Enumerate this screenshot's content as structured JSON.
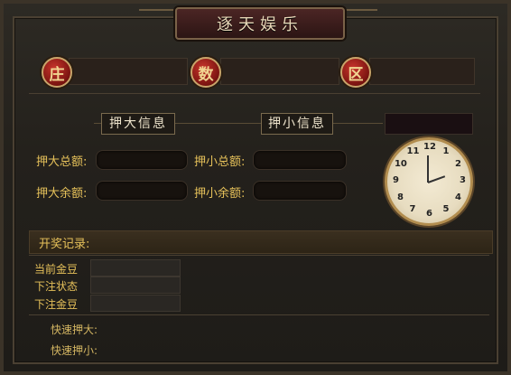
{
  "window": {
    "title": "逐天娱乐"
  },
  "orbs": {
    "left": "庄",
    "middle": "数",
    "right": "区"
  },
  "tabs": {
    "big_info": "押大信息",
    "small_info": "押小信息"
  },
  "labels": {
    "big_total": "押大总额:",
    "small_total": "押小总额:",
    "big_remaining": "押大余额:",
    "small_remaining": "押小余额:"
  },
  "records": {
    "label": "开奖记录:"
  },
  "status": {
    "gold_label": "当前金豆",
    "bet_status_label": "下注状态",
    "bet_gold_label": "下注金豆"
  },
  "quick": {
    "big_label": "快速押大:",
    "small_label": "快速押小:"
  },
  "clock": {
    "numerals": [
      "12",
      "1",
      "2",
      "3",
      "4",
      "5",
      "6",
      "7",
      "8",
      "9",
      "10",
      "11"
    ]
  }
}
